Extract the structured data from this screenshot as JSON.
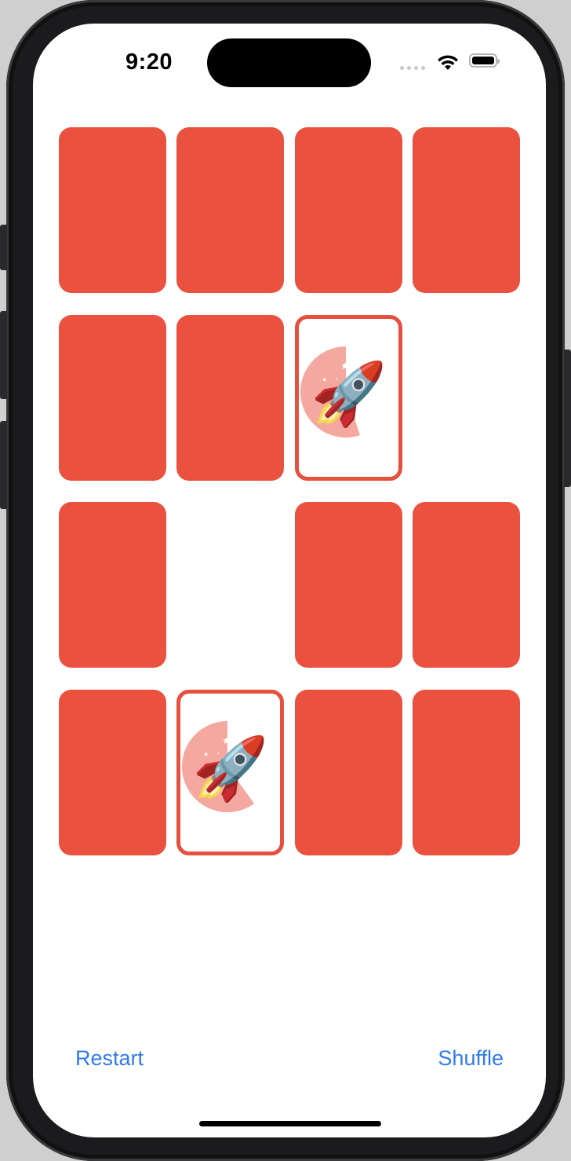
{
  "status_bar": {
    "time": "9:20"
  },
  "theme": {
    "card_color": "#ea513f",
    "button_color": "#2f7bea"
  },
  "cards": [
    {
      "state": "face-down",
      "content": ""
    },
    {
      "state": "face-down",
      "content": ""
    },
    {
      "state": "face-down",
      "content": ""
    },
    {
      "state": "face-down",
      "content": ""
    },
    {
      "state": "face-down",
      "content": ""
    },
    {
      "state": "face-down",
      "content": ""
    },
    {
      "state": "face-up",
      "content": "🚀",
      "timer_remaining_fraction": 0.55
    },
    {
      "state": "matched",
      "content": ""
    },
    {
      "state": "face-down",
      "content": ""
    },
    {
      "state": "matched",
      "content": ""
    },
    {
      "state": "face-down",
      "content": ""
    },
    {
      "state": "face-down",
      "content": ""
    },
    {
      "state": "face-down",
      "content": ""
    },
    {
      "state": "face-up",
      "content": "🚀",
      "timer_remaining_fraction": 0.6
    },
    {
      "state": "face-down",
      "content": ""
    },
    {
      "state": "face-down",
      "content": ""
    }
  ],
  "buttons": {
    "restart_label": "Restart",
    "shuffle_label": "Shuffle"
  }
}
